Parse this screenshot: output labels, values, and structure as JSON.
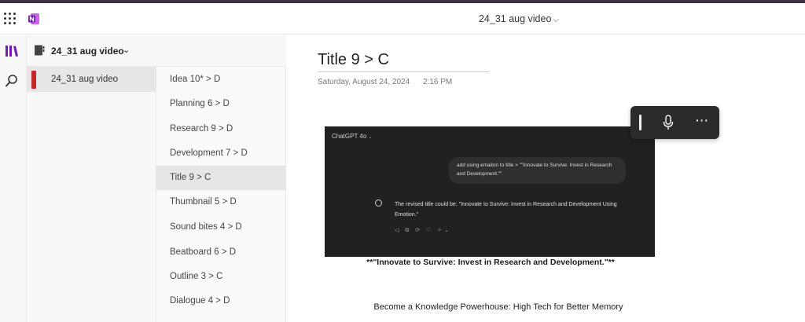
{
  "topbar": {
    "doc_title": "24_31 aug video",
    "chevron": "⌵",
    "apps_icon": "waffle-grid-icon",
    "app_logo": "onenote-logo"
  },
  "rail": {
    "icons": [
      "notebooks-icon",
      "search-icon"
    ]
  },
  "notebook": {
    "name": "24_31 aug video",
    "chevron": "⌄"
  },
  "sections": [
    {
      "label": "24_31 aug video",
      "color": "#c4262e",
      "selected": true
    }
  ],
  "pages": [
    {
      "label": "Idea 10* > D"
    },
    {
      "label": "Planning 6 > D"
    },
    {
      "label": "Research 9 > D"
    },
    {
      "label": "Development 7 > D"
    },
    {
      "label": "Title 9  > C",
      "selected": true
    },
    {
      "label": "Thumbnail 5 > D"
    },
    {
      "label": "Sound bites 4 > D"
    },
    {
      "label": "Beatboard 6 > D"
    },
    {
      "label": "Outline 3 > C"
    },
    {
      "label": "Dialogue 4 > D"
    }
  ],
  "page": {
    "title": "Title 9  > C",
    "date": "Saturday, August 24, 2024",
    "time": "2:16 PM",
    "caption": "**\"Innovate to Survive: Invest in Research and Development.\"**",
    "body_line": "Become a Knowledge Powerhouse: High Tech for Better Memory"
  },
  "embedded_screenshot": {
    "model": "ChatGPT 4o",
    "model_chevron": "⌄",
    "user_message": "add using emaiton to title > \"\"Innovate to Survive: Invest in Research and Development.\"\"",
    "reply": "The revised title could be: \"Innovate to Survive: Invest in Research and Development Using Emotion.\"",
    "actions": "◁ ⧉ ⟳ ♡ ✧⌄"
  },
  "float_toolbar": {
    "icons": [
      "text-cursor-icon",
      "microphone-icon",
      "more-icon"
    ],
    "more_label": "···"
  }
}
